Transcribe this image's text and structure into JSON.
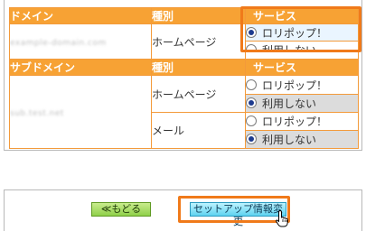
{
  "domain_table": {
    "header": {
      "col1": "ドメイン",
      "col2": "種別",
      "col3": "サービス"
    },
    "row": {
      "name": "example-domain.com",
      "type": "ホームページ",
      "options": [
        "ロリポップ！",
        "利用しない"
      ],
      "selected": 0
    }
  },
  "subdomain_table": {
    "header": {
      "col1": "サブドメイン",
      "col2": "種別",
      "col3": "サービス"
    },
    "name": "sub.test.net",
    "rows": [
      {
        "type": "ホームページ",
        "options": [
          "ロリポップ！",
          "利用しない"
        ],
        "selected": 1
      },
      {
        "type": "メール",
        "options": [
          "ロリポップ！",
          "利用しない"
        ],
        "selected": 1
      }
    ]
  },
  "footer": {
    "back_label": "≪もどる",
    "setup_label": "セットアップ情報変更"
  },
  "colors": {
    "header_bg": "#f7a234",
    "border": "#f39a3a",
    "highlight_outline": "#f07a1a",
    "back_button": "#8fd04a",
    "setup_button": "#5fd3f0"
  }
}
